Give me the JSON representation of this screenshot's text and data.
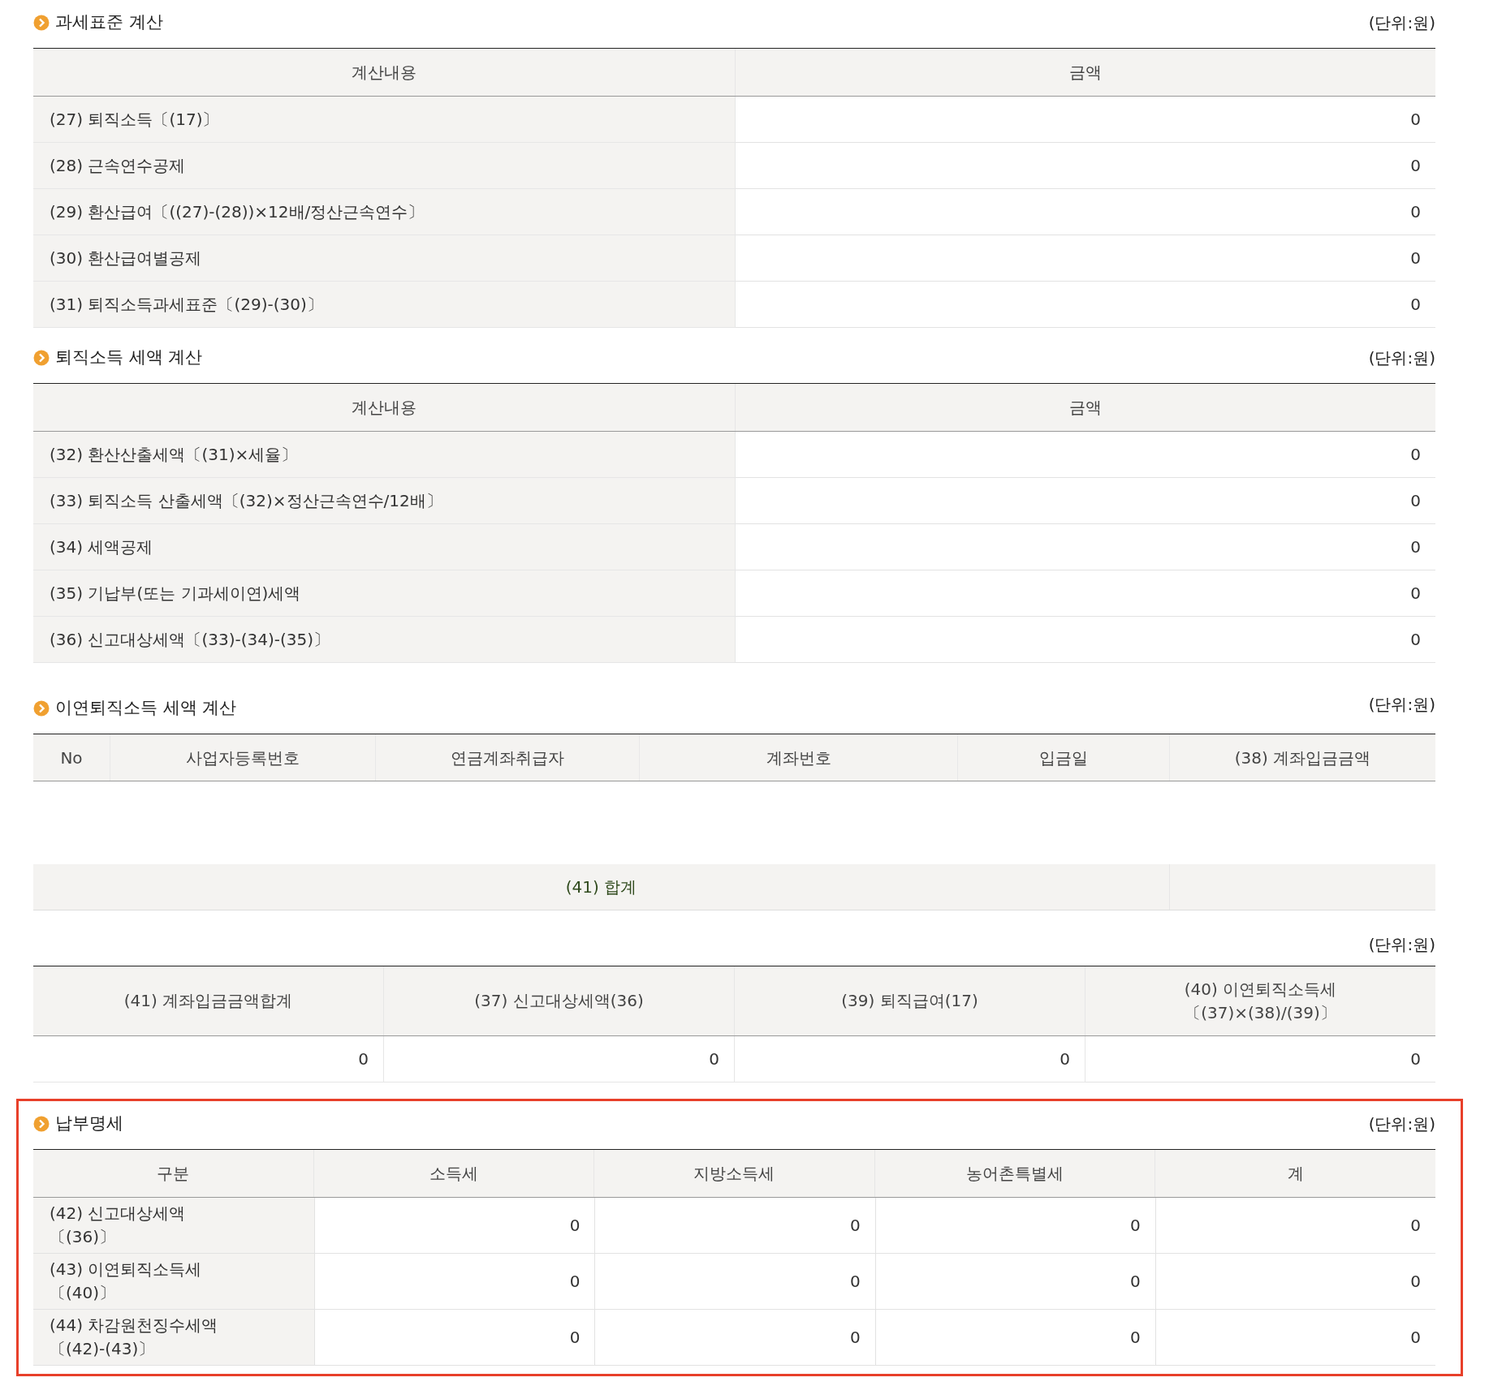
{
  "sections": [
    {
      "kind": "calc",
      "title": "과세표준 계산",
      "unit": "(단위:원)",
      "columns": [
        "계산내용",
        "금액"
      ],
      "rows": [
        {
          "label": "(27) 퇴직소득〔(17)〕",
          "amount": "0"
        },
        {
          "label": "(28) 근속연수공제",
          "amount": "0"
        },
        {
          "label": "(29) 환산급여〔((27)-(28))×12배/정산근속연수〕",
          "amount": "0"
        },
        {
          "label": "(30) 환산급여별공제",
          "amount": "0"
        },
        {
          "label": "(31) 퇴직소득과세표준〔(29)-(30)〕",
          "amount": "0"
        }
      ]
    },
    {
      "kind": "calc",
      "title": "퇴직소득 세액 계산",
      "unit": "(단위:원)",
      "columns": [
        "계산내용",
        "금액"
      ],
      "rows": [
        {
          "label": "(32) 환산산출세액〔(31)×세율〕",
          "amount": "0"
        },
        {
          "label": "(33) 퇴직소득 산출세액〔(32)×정산근속연수/12배〕",
          "amount": "0"
        },
        {
          "label": "(34) 세액공제",
          "amount": "0"
        },
        {
          "label": "(35) 기납부(또는 기과세이연)세액",
          "amount": "0"
        },
        {
          "label": "(36) 신고대상세액〔(33)-(34)-(35)〕",
          "amount": "0"
        }
      ]
    },
    {
      "kind": "list",
      "title": "이연퇴직소득 세액 계산",
      "unit": "(단위:원)",
      "columns": [
        "No",
        "사업자등록번호",
        "연금계좌취급자",
        "계좌번호",
        "입금일",
        "(38) 계좌입금금액"
      ],
      "total": "(41) 합계"
    },
    {
      "kind": "grid",
      "unit": "(단위:원)",
      "columns": [
        [
          "(41) 계좌입금금액합계"
        ],
        [
          "(37) 신고대상세액(36)"
        ],
        [
          "(39) 퇴직급여(17)"
        ],
        [
          "(40) 이연퇴직소득세",
          "〔(37)×(38)/(39)〕"
        ]
      ],
      "values": [
        "0",
        "0",
        "0",
        "0"
      ]
    },
    {
      "kind": "payment",
      "title": "납부명세",
      "unit": "(단위:원)",
      "highlighted": true,
      "columns": [
        "구분",
        "소득세",
        "지방소득세",
        "농어촌특별세",
        "계"
      ],
      "rows": [
        {
          "label": [
            "(42) 신고대상세액",
            "〔(36)〕"
          ],
          "values": [
            "0",
            "0",
            "0",
            "0"
          ]
        },
        {
          "label": [
            "(43) 이연퇴직소득세",
            "〔(40)〕"
          ],
          "values": [
            "0",
            "0",
            "0",
            "0"
          ]
        },
        {
          "label": [
            "(44) 차감원천징수세액",
            "〔(42)-(43)〕"
          ],
          "values": [
            "0",
            "0",
            "0",
            "0"
          ]
        }
      ]
    }
  ]
}
